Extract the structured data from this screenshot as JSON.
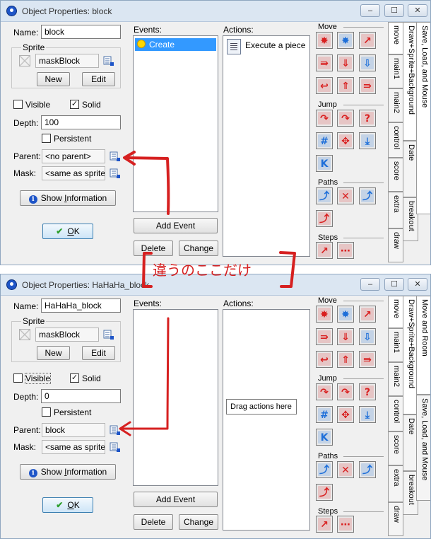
{
  "top": {
    "title": "Object Properties: block",
    "name_label": "Name:",
    "name_value": "block",
    "sprite_label": "Sprite",
    "sprite_value": "maskBlock",
    "new_label": "New",
    "edit_label": "Edit",
    "visible_label": "Visible",
    "visible_checked": false,
    "solid_label": "Solid",
    "solid_checked": true,
    "depth_label": "Depth:",
    "depth_value": "100",
    "persistent_label": "Persistent",
    "persistent_checked": false,
    "parent_label": "Parent:",
    "parent_value": "<no parent>",
    "mask_label": "Mask:",
    "mask_value": "<same as sprite>",
    "info_label": "Show Information",
    "info_underline_index": 5,
    "ok_label": "OK",
    "events_label": "Events:",
    "events": [
      "Create"
    ],
    "actions_label": "Actions:",
    "actions": [
      "Execute a piece o"
    ],
    "add_event_label": "Add Event",
    "delete_label": "Delete",
    "change_label": "Change",
    "helper_text": ""
  },
  "bottom": {
    "title": "Object Properties: HaHaHa_block",
    "name_label": "Name:",
    "name_value": "HaHaHa_block",
    "sprite_label": "Sprite",
    "sprite_value": "maskBlock",
    "new_label": "New",
    "edit_label": "Edit",
    "visible_label": "Visible",
    "visible_checked": false,
    "solid_label": "Solid",
    "solid_checked": true,
    "depth_label": "Depth:",
    "depth_value": "0",
    "persistent_label": "Persistent",
    "persistent_checked": false,
    "parent_label": "Parent:",
    "parent_value": "block",
    "mask_label": "Mask:",
    "mask_value": "<same as sprite>",
    "info_label": "Show Information",
    "info_underline_index": 5,
    "ok_label": "OK",
    "events_label": "Events:",
    "events": [],
    "actions_label": "Actions:",
    "actions": [],
    "add_event_label": "Add Event",
    "delete_label": "Delete",
    "change_label": "Change",
    "helper_text": "Drag actions here"
  },
  "palette": {
    "sections": [
      "Move",
      "Jump",
      "Paths",
      "Steps"
    ],
    "icons": [
      {
        "name": "move-fixed-icon",
        "section": "Move",
        "color": "#d92020",
        "glyph": "✸"
      },
      {
        "name": "move-free-icon",
        "section": "Move",
        "color": "#1e6fd9",
        "glyph": "✸"
      },
      {
        "name": "move-towards-icon",
        "section": "Move",
        "color": "#d92020",
        "glyph": "↗"
      },
      {
        "name": "speed-horizontal-icon",
        "section": "Move",
        "color": "#d92020",
        "glyph": "⇛"
      },
      {
        "name": "speed-vertical-icon",
        "section": "Move",
        "color": "#d92020",
        "glyph": "⇓"
      },
      {
        "name": "set-gravity-icon",
        "section": "Move",
        "color": "#1e6fd9",
        "glyph": "⇩"
      },
      {
        "name": "reverse-horizontal-icon",
        "section": "Move",
        "color": "#d92020",
        "glyph": "↩"
      },
      {
        "name": "reverse-vertical-icon",
        "section": "Move",
        "color": "#d92020",
        "glyph": "⇑"
      },
      {
        "name": "set-friction-icon",
        "section": "Move",
        "color": "#d92020",
        "glyph": "⇛"
      },
      {
        "name": "jump-to-position-icon",
        "section": "Jump",
        "color": "#d92020",
        "glyph": "↷"
      },
      {
        "name": "jump-to-start-icon",
        "section": "Jump",
        "color": "#d92020",
        "glyph": "↷"
      },
      {
        "name": "jump-to-random-icon",
        "section": "Jump",
        "color": "#d92020",
        "glyph": "?"
      },
      {
        "name": "align-to-grid-icon",
        "section": "Jump",
        "color": "#1e6fd9",
        "glyph": "#"
      },
      {
        "name": "wrap-screen-icon",
        "section": "Jump",
        "color": "#d92020",
        "glyph": "✥"
      },
      {
        "name": "move-to-contact-icon",
        "section": "Jump",
        "color": "#1e6fd9",
        "glyph": "⤓"
      },
      {
        "name": "bounce-icon",
        "section": "Jump",
        "color": "#1e6fd9",
        "glyph": "K"
      },
      {
        "name": "set-path-icon",
        "section": "Paths",
        "color": "#1e6fd9",
        "glyph": "⤴"
      },
      {
        "name": "end-path-icon",
        "section": "Paths",
        "color": "#d92020",
        "glyph": "✕"
      },
      {
        "name": "path-position-icon",
        "section": "Paths",
        "color": "#1e6fd9",
        "glyph": "⤴"
      },
      {
        "name": "path-speed-icon",
        "section": "Paths",
        "color": "#d92020",
        "glyph": "⤴"
      },
      {
        "name": "step-towards-icon",
        "section": "Steps",
        "color": "#d92020",
        "glyph": "↗"
      },
      {
        "name": "step-avoiding-icon",
        "section": "Steps",
        "color": "#d92020",
        "glyph": "⋯"
      }
    ]
  },
  "tabs": {
    "col1": [
      "move",
      "main1",
      "main2",
      "control",
      "score",
      "extra",
      "draw"
    ],
    "col2": [
      "Draw+Sprite+Background",
      "Date",
      "breakout"
    ],
    "col3_top": [
      "Save, Load, and Mouse"
    ],
    "col3_bottom": [
      "Move and Room",
      "Save, Load, and Mouse"
    ],
    "col2_bottom": [
      "Draw+Sprite+Background",
      "Date",
      "breakout"
    ]
  },
  "annotation": {
    "text": "違うのここだけ",
    "color": "#d62020"
  }
}
